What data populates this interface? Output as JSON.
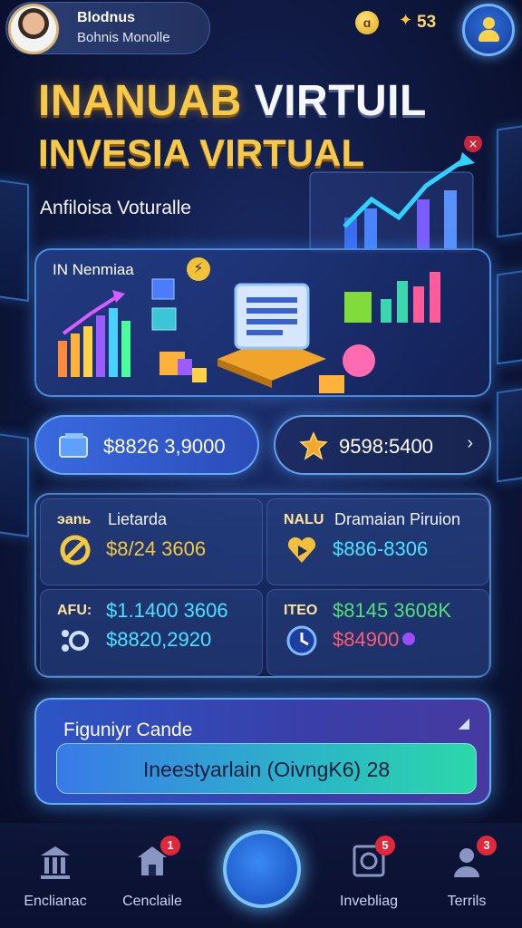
{
  "profile": {
    "name": "Blodnus",
    "subtitle": "Bohnis Monolle"
  },
  "currency": {
    "coin_symbol": "ɑ",
    "gem_count": "53"
  },
  "hero": {
    "title_gold": "INANUAB",
    "title_white": "VIRTUIL",
    "title_line2": "INVESIA VIRTUAL",
    "subtitle": "Anfilo​isa Voturalle",
    "card_label": "IN Nenmiaa"
  },
  "pills": {
    "left_value": "$8826 3,9000",
    "right_value": "9598:5400"
  },
  "stats": [
    {
      "tag": "эanь",
      "title": "Lietarda",
      "value": "$8/24 3606",
      "color": "#f2c93f"
    },
    {
      "tag": "NALU",
      "title": "Dramaian Piruion",
      "value": "$886-8306",
      "color": "#49e2ff"
    },
    {
      "tag": "AFU:",
      "line1": "$1.1400 3606",
      "value": "$8820,2920",
      "color1": "#49e2ff",
      "color": "#49e2ff"
    },
    {
      "tag": "ITEO",
      "line1": "$8145 3608K",
      "value": "$84900",
      "color1": "#4fe07a",
      "color": "#ff5a78"
    }
  ],
  "cta": {
    "title": "Figuniyr Cande",
    "button_label": "Ineestyarlain (OivngK6) 28"
  },
  "nav": {
    "items": [
      {
        "label": "Enclianac",
        "badge": ""
      },
      {
        "label": "Cenclaile",
        "badge": "1"
      },
      {
        "label": "Invebliag",
        "badge": "5"
      },
      {
        "label": "Terrils",
        "badge": "3"
      }
    ]
  },
  "colors": {
    "gold": "#f6c94a",
    "accent_blue": "#3a6ae0",
    "background": "#101a44"
  }
}
